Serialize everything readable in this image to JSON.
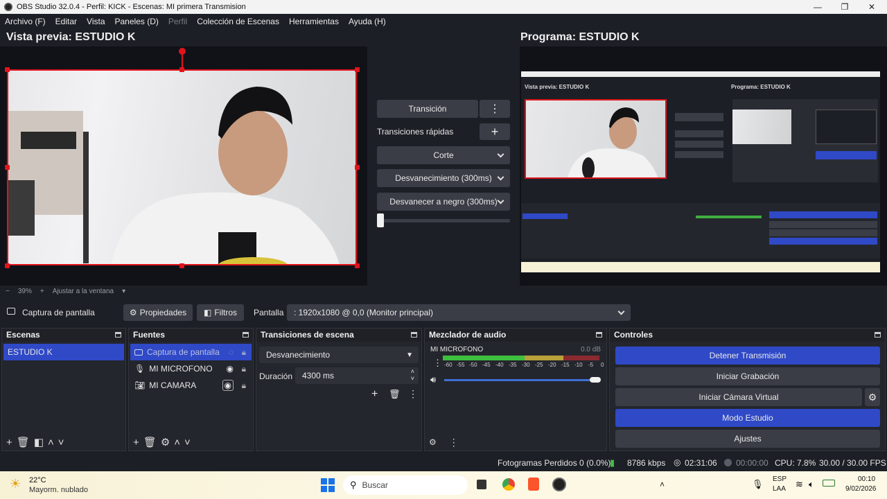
{
  "window": {
    "title": "OBS Studio 32.0.4 - Perfil: KICK - Escenas: MI primera Transmision"
  },
  "menu": [
    "Archivo (F)",
    "Editar",
    "Vista",
    "Paneles (D)",
    "Perfil",
    "Colección de Escenas",
    "Herramientas",
    "Ayuda (H)"
  ],
  "preview": {
    "title": "Vista previa: ESTUDIO K",
    "zoom": "39%",
    "fit_label": "Ajustar a la ventana"
  },
  "program": {
    "title": "Programa: ESTUDIO K"
  },
  "transitions": {
    "transition_button": "Transición",
    "quick_label": "Transiciones rápidas",
    "items": [
      "Corte",
      "Desvanecimiento (300ms)",
      "Desvanecer a negro (300ms)"
    ]
  },
  "source_bar": {
    "source_name": "Captura de pantalla",
    "properties": "Propiedades",
    "filters": "Filtros",
    "display_label": "Pantalla",
    "display_value": ": 1920x1080 @ 0,0 (Monitor principal)"
  },
  "scenes": {
    "title": "Escenas",
    "items": [
      "ESTUDIO K"
    ]
  },
  "sources": {
    "title": "Fuentes",
    "items": [
      "Captura de pantalla",
      "MI MICROFONO",
      "MI CAMARA"
    ]
  },
  "scene_transitions": {
    "title": "Transiciones de escena",
    "selected": "Desvanecimiento",
    "duration_label": "Duración",
    "duration_value": "4300 ms"
  },
  "mixer": {
    "title": "Mezclador de audio",
    "channel": "MI MICROFONO",
    "db": "0.0 dB",
    "ticks": [
      "-60",
      "-55",
      "-50",
      "-45",
      "-40",
      "-35",
      "-30",
      "-25",
      "-20",
      "-15",
      "-10",
      "-5",
      "0"
    ],
    "volume_level": 1.0
  },
  "controls": {
    "title": "Controles",
    "buttons": [
      "Detener Transmisión",
      "Iniciar Grabación",
      "Iniciar Cámara Virtual",
      "Modo Estudio",
      "Ajustes"
    ]
  },
  "status": {
    "dropped": "Fotogramas Perdidos 0 (0.0%)",
    "bitrate": "8786 kbps",
    "stream_time": "02:31:06",
    "rec_time": "00:00:00",
    "cpu": "CPU: 7.8%",
    "fps": "30.00 / 30.00 FPS"
  },
  "taskbar": {
    "temp": "22°C",
    "weather": "Mayorm. nublado",
    "search": "Buscar",
    "lang1": "ESP",
    "lang2": "LAA",
    "time": "00:10",
    "date": "9/02/2026"
  },
  "colors": {
    "accent": "#2f49c7",
    "selection": "#e0141b",
    "bg": "#1d1f26"
  }
}
